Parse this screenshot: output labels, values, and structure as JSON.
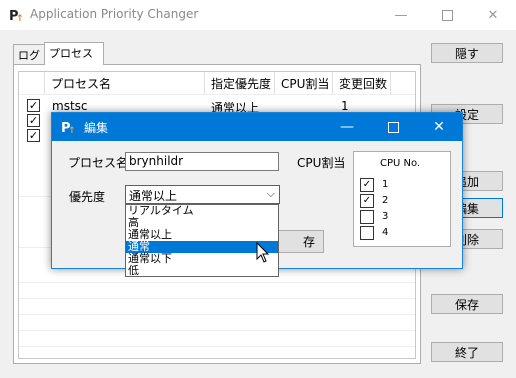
{
  "window": {
    "title": "Application Priority Changer"
  },
  "tabs": [
    {
      "label": "ログ"
    },
    {
      "label": "プロセス"
    }
  ],
  "table": {
    "columns": [
      "プロセス名",
      "指定優先度",
      "CPU割当",
      "変更回数"
    ],
    "rows": [
      {
        "checked": true,
        "name": "mstsc",
        "priority": "通常以上",
        "cpu": "",
        "count": "1"
      },
      {
        "checked": true,
        "name": "",
        "priority": "",
        "cpu": "",
        "count": ""
      },
      {
        "checked": true,
        "name": "",
        "priority": "",
        "cpu": "",
        "count": ""
      }
    ]
  },
  "buttons": {
    "hide": "隠す",
    "settings": "設定",
    "add": "追加",
    "edit": "編集",
    "delete": "削除",
    "save": "保存",
    "exit": "終了"
  },
  "dialog": {
    "title": "編集",
    "name_label": "プロセス名",
    "name_value": "brynhildr",
    "priority_label": "優先度",
    "priority_value": "通常以上",
    "cpu_label": "CPU割当",
    "cpu_header": "CPU No.",
    "hidden_button_fragment": "存",
    "cpus": [
      {
        "no": "1",
        "checked": true
      },
      {
        "no": "2",
        "checked": true
      },
      {
        "no": "3",
        "checked": false
      },
      {
        "no": "4",
        "checked": false
      }
    ]
  },
  "dropdown": {
    "options": [
      "リアルタイム",
      "高",
      "通常以上",
      "通常",
      "通常以下",
      "低"
    ],
    "highlighted": "通常"
  },
  "colors": {
    "accent": "#0078d7",
    "titlebar": "#ffffff",
    "window_bg": "#f0f0f0"
  }
}
